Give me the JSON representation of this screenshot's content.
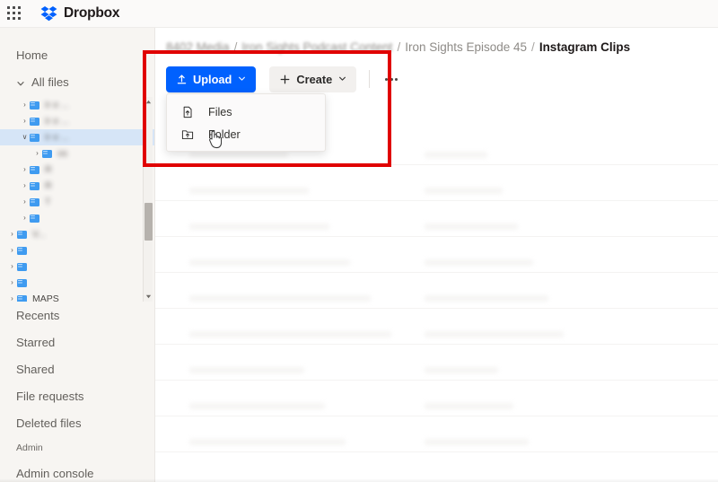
{
  "app": {
    "name": "Dropbox",
    "launcher_icon": "grid-apps-icon",
    "logo_icon": "dropbox-logo-icon"
  },
  "sidebar": {
    "primary": [
      {
        "label": "Home",
        "icon": ""
      },
      {
        "label": "All files",
        "icon": "chevron-down-icon",
        "expanded": true
      }
    ],
    "tree": [
      {
        "label": "Ir                        e ...",
        "indent": 1,
        "caret": "›",
        "selected": false,
        "blurred": true
      },
      {
        "label": "Ir                        e ...",
        "indent": 1,
        "caret": "›",
        "selected": false,
        "blurred": true
      },
      {
        "label": "Ir                        e ...",
        "indent": 1,
        "caret": "∨",
        "selected": true,
        "blurred": true
      },
      {
        "label": "                       os",
        "indent": 2,
        "caret": "›",
        "selected": false,
        "blurred": true
      },
      {
        "label": "R                        ",
        "indent": 1,
        "caret": "›",
        "selected": false,
        "blurred": true
      },
      {
        "label": "R                        ",
        "indent": 1,
        "caret": "›",
        "selected": false,
        "blurred": true
      },
      {
        "label": "T                        ",
        "indent": 1,
        "caret": "›",
        "selected": false,
        "blurred": true
      },
      {
        "label": "                         ",
        "indent": 1,
        "caret": "›",
        "selected": false,
        "blurred": true
      },
      {
        "label": "                      V...",
        "indent": 0,
        "caret": "›",
        "selected": false,
        "blurred": true
      },
      {
        "label": "                         ",
        "indent": 0,
        "caret": "›",
        "selected": false,
        "blurred": true
      },
      {
        "label": "                         ",
        "indent": 0,
        "caret": "›",
        "selected": false,
        "blurred": true
      },
      {
        "label": "                         ",
        "indent": 0,
        "caret": "›",
        "selected": false,
        "blurred": true
      },
      {
        "label": "MAPS            ",
        "indent": 0,
        "caret": "›",
        "selected": false,
        "blurred": false
      }
    ],
    "secondary": [
      {
        "label": "Recents"
      },
      {
        "label": "Starred"
      },
      {
        "label": "Shared"
      },
      {
        "label": "File requests"
      },
      {
        "label": "Deleted files"
      }
    ],
    "section_label": "Admin",
    "admin": [
      {
        "label": "Admin console"
      }
    ],
    "scrollbar": {
      "up_arrow": "▲",
      "down_arrow": "▼"
    }
  },
  "breadcrumb": {
    "separator": "/",
    "items": [
      {
        "label": "8402 Media",
        "blurred": true,
        "current": false
      },
      {
        "label": "Iron Sights Podcast Content",
        "blurred": true,
        "current": false
      },
      {
        "label": "Iron Sights Episode 45",
        "blurred": false,
        "current": false
      },
      {
        "label": "Instagram Clips",
        "blurred": false,
        "current": true
      }
    ]
  },
  "toolbar": {
    "upload_label": "Upload",
    "upload_icon": "upload-arrow-icon",
    "upload_caret": "⌄",
    "create_label": "Create",
    "create_icon": "plus-icon",
    "create_caret": "⌄",
    "more_label": "…",
    "more_icon": "ellipsis-icon"
  },
  "upload_menu": {
    "open": true,
    "items": [
      {
        "label": "Files",
        "icon": "file-upload-icon"
      },
      {
        "label": "Folder",
        "icon": "folder-upload-icon"
      }
    ]
  },
  "cursor": {
    "icon": "pointing-hand-cursor"
  },
  "highlight": {
    "color": "#e00000",
    "target": "upload-menu-region"
  },
  "colors": {
    "brand_blue": "#0061fe",
    "sidebar_bg": "#f7f5f2",
    "selection_blue": "#d6e5f7",
    "highlight_red": "#e00000",
    "folder_blue": "#3f9bf0"
  }
}
